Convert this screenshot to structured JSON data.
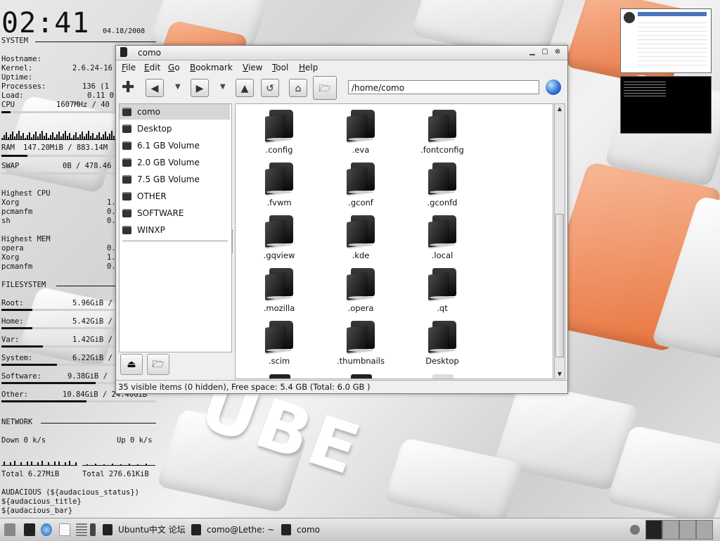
{
  "conky": {
    "time": "02:41",
    "date": "04.18/2008",
    "system_label": "SYSTEM",
    "hostname_label": "Hostname:",
    "kernel_label": "Kernel:",
    "kernel_value": "2.6.24-16",
    "uptime_label": "Uptime:",
    "processes_label": "Processes:",
    "processes_value": "136 (1",
    "load_label": "Load:",
    "load_value": "0.11 0",
    "cpu_label": "CPU",
    "cpu_value": "1607MHz / 40",
    "cpu_fraction": 0.06,
    "ram_label": "RAM",
    "ram_value": "147.20MiB / 883.14M",
    "ram_fraction": 0.17,
    "swap_label": "SWAP",
    "swap_value": "0B / 478.46",
    "swap_fraction": 0.0,
    "highest_cpu_label": "Highest CPU",
    "highest_cpu": [
      {
        "name": "Xorg",
        "value": "1."
      },
      {
        "name": "pcmanfm",
        "value": "0."
      },
      {
        "name": "sh",
        "value": "0."
      }
    ],
    "highest_mem_label": "Highest MEM",
    "highest_mem": [
      {
        "name": "opera",
        "value": "0."
      },
      {
        "name": "Xorg",
        "value": "1."
      },
      {
        "name": "pcmanfm",
        "value": "0."
      }
    ],
    "filesystem_label": "FILESYSTEM",
    "filesystems": [
      {
        "label": "Root:",
        "value": "5.96GiB /",
        "fraction": 0.2
      },
      {
        "label": "Home:",
        "value": "5.42GiB /",
        "fraction": 0.2
      },
      {
        "label": "Var:",
        "value": "1.42GiB /",
        "fraction": 0.27
      },
      {
        "label": "System:",
        "value": "6.22GiB /",
        "fraction": 0.36
      },
      {
        "label": "Software:",
        "value": "9.38GiB /",
        "fraction": 0.61
      },
      {
        "label": "Other:",
        "value": "10.84GiB / 24.40GiB",
        "fraction": 0.55
      }
    ],
    "network_label": "NETWORK",
    "down_label": "Down 0 k/s",
    "up_label": "Up 0 k/s",
    "total_down": "Total 6.27MiB",
    "total_up": "Total 276.61KiB",
    "audacious_label": "AUDACIOUS (${audacious_status})",
    "audacious_title": "${audacious_title}",
    "audacious_bar": "${audacious_bar}"
  },
  "window": {
    "title": "como",
    "menus": [
      "File",
      "Edit",
      "Go",
      "Bookmark",
      "View",
      "Tool",
      "Help"
    ],
    "address": "/home/como",
    "sidebar": [
      {
        "label": "como",
        "selected": true
      },
      {
        "label": "Desktop"
      },
      {
        "label": "6.1 GB Volume"
      },
      {
        "label": "2.0 GB Volume"
      },
      {
        "label": "7.5 GB Volume"
      },
      {
        "label": "OTHER"
      },
      {
        "label": "SOFTWARE"
      },
      {
        "label": "WINXP"
      }
    ],
    "files": [
      ".config",
      ".eva",
      ".fontconfig",
      ".fvwm",
      ".gconf",
      ".gconfd",
      ".gqview",
      ".kde",
      ".local",
      ".mozilla",
      ".opera",
      ".qt",
      ".scim",
      ".thumbnails",
      "Desktop"
    ],
    "status": "35 visible items (0 hidden), Free space: 5.4 GB (Total: 6.0 GB )"
  },
  "taskbar": {
    "tasks": [
      {
        "label": "Ubuntu中文 论坛"
      },
      {
        "label": "como@Lethe: ~"
      },
      {
        "label": "como"
      }
    ]
  },
  "wallpaper": {
    "text": "UBE"
  }
}
